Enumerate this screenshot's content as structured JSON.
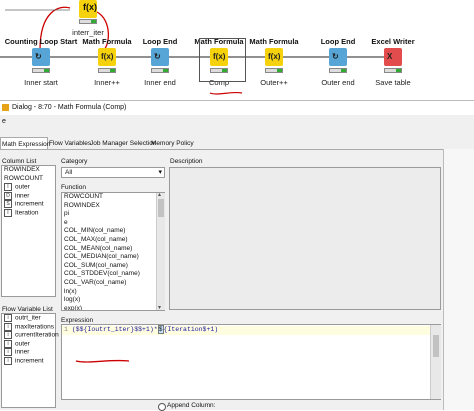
{
  "workflow": {
    "nodes": [
      {
        "title": "Counting Loop Start",
        "subtitle": "Inner start",
        "color": "#57a5d6"
      },
      {
        "title": "Math Formula",
        "subtitle": "Inner++",
        "color": "#f5d20b"
      },
      {
        "title": "Loop End",
        "subtitle": "Inner end",
        "color": "#57a5d6"
      },
      {
        "title": "Math Formula",
        "subtitle": "Comp",
        "color": "#f5d20b"
      },
      {
        "title": "Math Formula",
        "subtitle": "Outer++",
        "color": "#f5d20b"
      },
      {
        "title": "Loop End",
        "subtitle": "Outer end",
        "color": "#57a5d6"
      },
      {
        "title": "Excel Writer",
        "subtitle": "Save table",
        "color": "#e34c4c"
      }
    ],
    "top_node": {
      "subtitle": "interr_iter",
      "color": "#f5d20b"
    },
    "colors": {
      "connection": "#222222",
      "flow_var": "#cc0000",
      "selection": "#cc0000",
      "ok": "#33aa33",
      "idle": "#dddddd"
    }
  },
  "dialog": {
    "title": "Dialog - 8:70 - Math Formula (Comp)",
    "menu": "e",
    "tabs": [
      "Math Expression",
      "Flow Variables",
      "Job Manager Selection",
      "Memory Policy"
    ],
    "column_list": {
      "label": "Column List",
      "items": [
        {
          "badge": "",
          "name": "ROWINDEX"
        },
        {
          "badge": "",
          "name": "ROWCOUNT"
        },
        {
          "badge": "I",
          "name": "outer"
        },
        {
          "badge": "D",
          "name": "inner"
        },
        {
          "badge": "S",
          "name": "increment"
        },
        {
          "badge": "I",
          "name": "Iteration"
        }
      ]
    },
    "flow_variable_list": {
      "label": "Flow Variable List",
      "items": [
        {
          "badge": "i",
          "name": "outrt_iter"
        },
        {
          "badge": "i",
          "name": "maxIterations"
        },
        {
          "badge": "i",
          "name": "currentIteration"
        },
        {
          "badge": "i",
          "name": "outer"
        },
        {
          "badge": "i",
          "name": "inner"
        },
        {
          "badge": "i",
          "name": "increment"
        }
      ]
    },
    "category": {
      "label": "Category",
      "selected": "All"
    },
    "description": {
      "label": "Description"
    },
    "function": {
      "label": "Function",
      "items": [
        "ROWCOUNT",
        "ROWINDEX",
        "pi",
        "e",
        "COL_MIN(col_name)",
        "COL_MAX(col_name)",
        "COL_MEAN(col_name)",
        "COL_MEDIAN(col_name)",
        "COL_SUM(col_name)",
        "COL_STDDEV(col_name)",
        "COL_VAR(col_name)",
        "ln(x)",
        "log(x)",
        "exp(x)"
      ]
    },
    "expression": {
      "label": "Expression",
      "parts": [
        "($${Ioutrt_iter}$$+1)*",
        "$",
        "{Iteration$+1)"
      ]
    },
    "append_column_label": "Append Column:"
  }
}
